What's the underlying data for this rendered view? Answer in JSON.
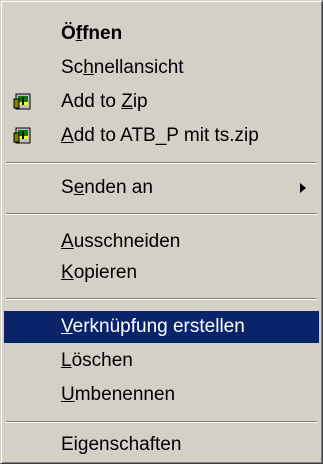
{
  "menu": {
    "items": [
      {
        "pre": "Ö",
        "acc": "f",
        "post": "fnen"
      },
      {
        "pre": "Sc",
        "acc": "h",
        "post": "nellansicht"
      },
      {
        "pre": "Add to ",
        "acc": "Z",
        "post": "ip",
        "icon": "winzip-icon"
      },
      {
        "pre": "",
        "acc": "A",
        "post": "dd to ATB_P mit ts.zip",
        "icon": "winzip-icon"
      },
      {
        "pre": "S",
        "acc": "e",
        "post": "nden an"
      },
      {
        "pre": "",
        "acc": "A",
        "post": "usschneiden"
      },
      {
        "pre": "",
        "acc": "K",
        "post": "opieren"
      },
      {
        "pre": "",
        "acc": "V",
        "post": "erknüpfung erstellen"
      },
      {
        "pre": "",
        "acc": "L",
        "post": "öschen"
      },
      {
        "pre": "",
        "acc": "U",
        "post": "mbenennen"
      },
      {
        "pre": "Ei",
        "acc": "g",
        "post": "enschaften"
      }
    ]
  },
  "colors": {
    "menu_background": "#d4d0c8",
    "highlight_background": "#0a246a",
    "highlight_text": "#ffffff",
    "text": "#000000"
  }
}
